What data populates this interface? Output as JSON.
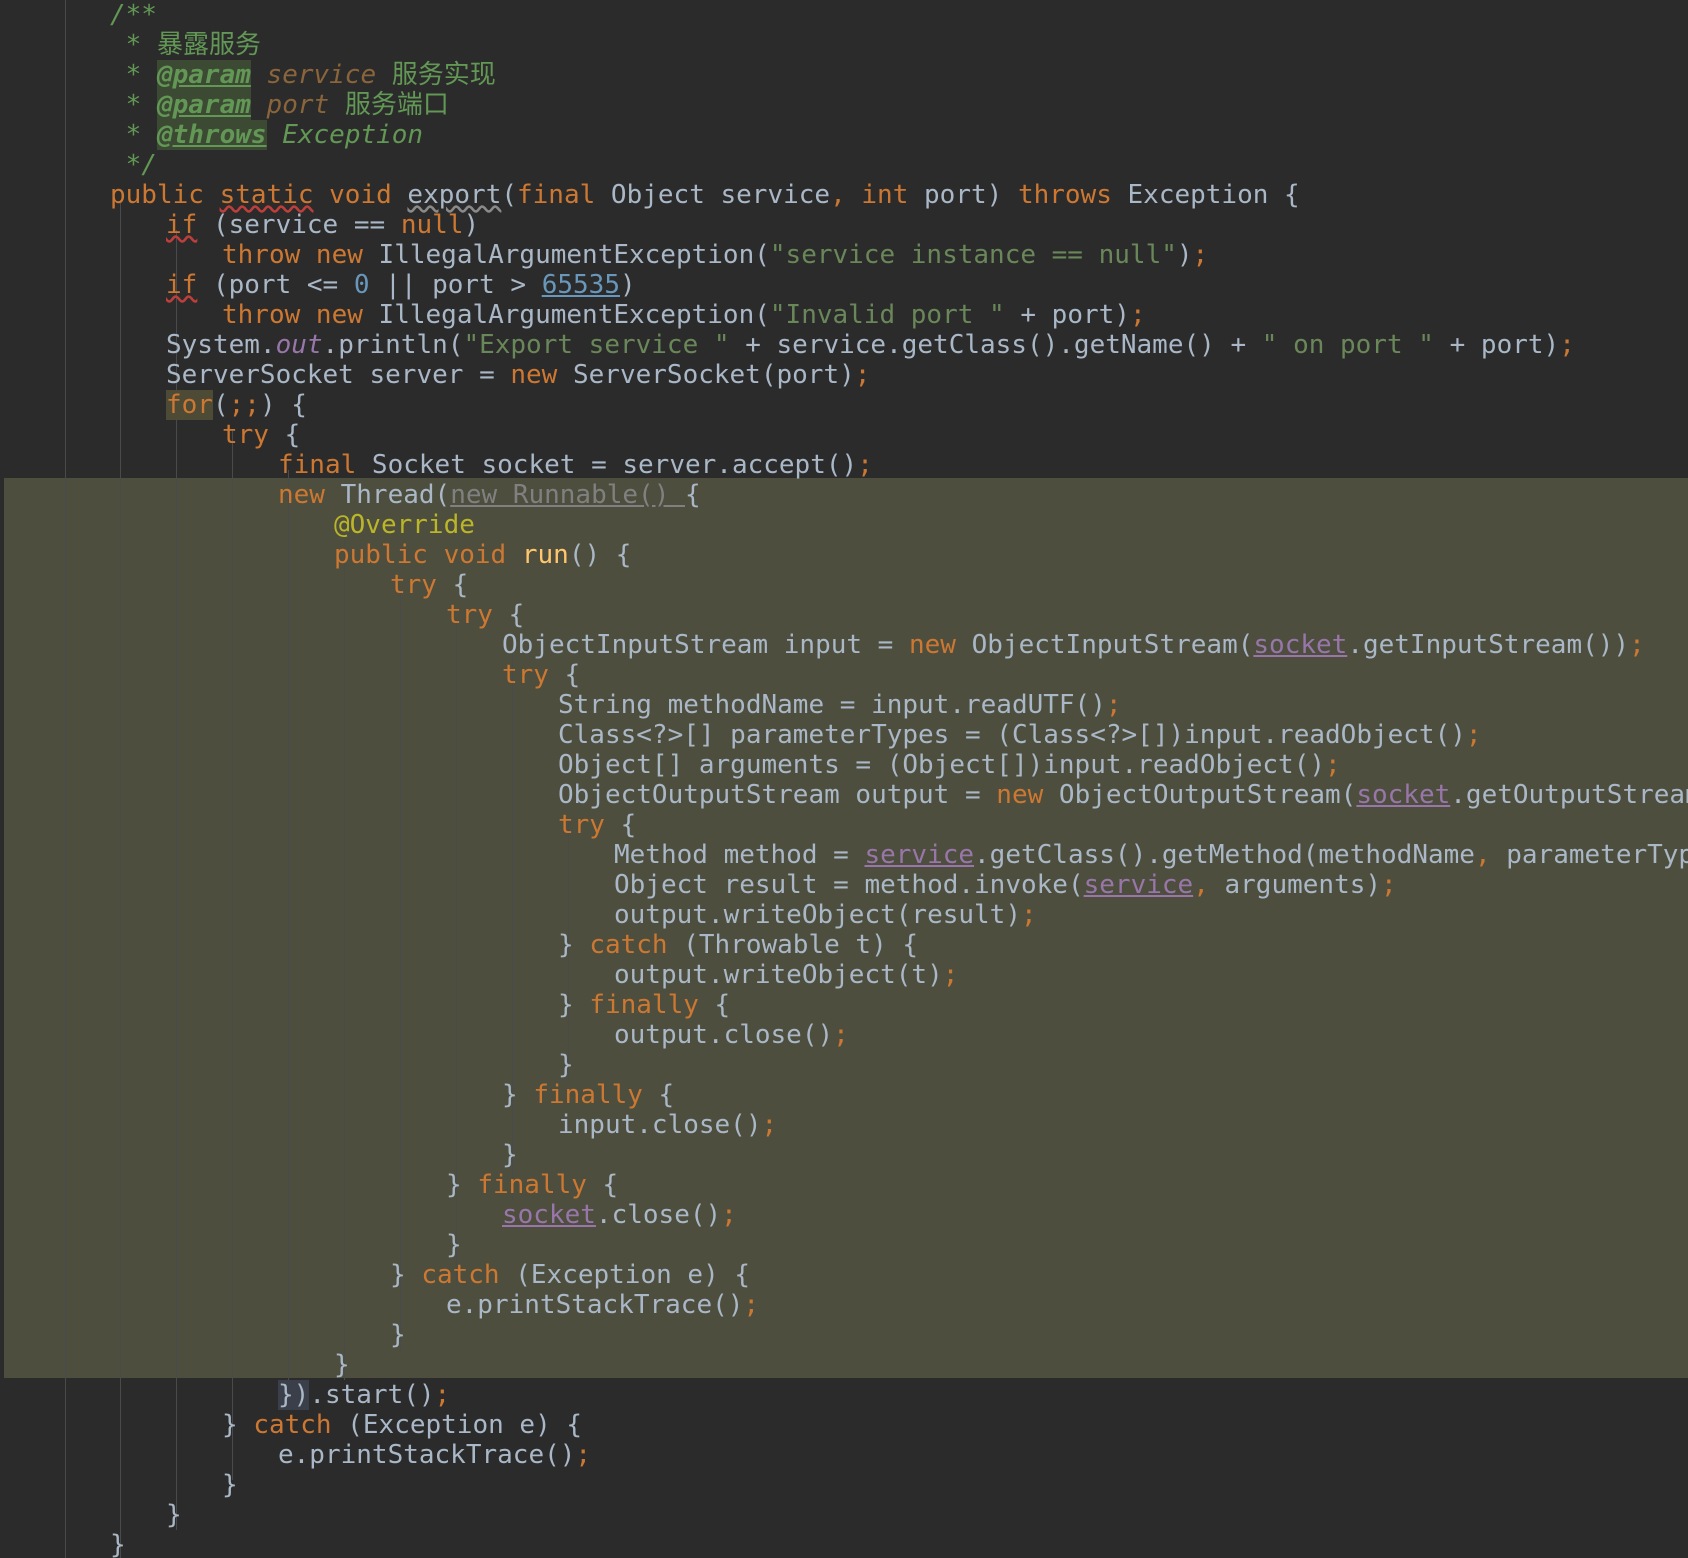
{
  "editor": {
    "colors": {
      "background": "#2b2b2b",
      "highlight_band": "#4d4e3d",
      "keyword": "#cc7832",
      "string": "#6a8759",
      "comment": "#629755",
      "number": "#6897bb",
      "method_decl": "#ffc66d",
      "field": "#9876aa",
      "annotation": "#bbb529",
      "plain": "#a9b7c6"
    },
    "lines": [
      [
        [
          "c-cmt",
          "/**"
        ]
      ],
      [
        [
          "c-cmt",
          " * "
        ],
        [
          "c-cmt-cjk",
          "暴露服务"
        ]
      ],
      [
        [
          "c-cmt",
          " * "
        ],
        [
          "c-tag",
          "@param"
        ],
        [
          "c-pname",
          " service "
        ],
        [
          "c-cmt-cjk",
          "服务实现"
        ]
      ],
      [
        [
          "c-cmt",
          " * "
        ],
        [
          "c-tag",
          "@param"
        ],
        [
          "c-pname",
          " port "
        ],
        [
          "c-cmt-cjk",
          "服务端口"
        ]
      ],
      [
        [
          "c-cmt",
          " * "
        ],
        [
          "c-tag",
          "@throws"
        ],
        [
          "c-cmt",
          " Exception"
        ]
      ],
      [
        [
          "c-cmt",
          " */"
        ]
      ],
      [
        [
          "c-kw",
          "public "
        ],
        [
          "c-kwsq",
          "static"
        ],
        [
          "c-kw",
          " void "
        ],
        [
          "c-plainsq",
          "export"
        ],
        [
          "c-plain",
          "("
        ],
        [
          "c-kw",
          "final "
        ],
        [
          "c-plain",
          "Object service"
        ],
        [
          "c-punct",
          ", "
        ],
        [
          "c-kw",
          "int "
        ],
        [
          "c-plain",
          "port) "
        ],
        [
          "c-kw",
          "throws "
        ],
        [
          "c-plain",
          "Exception {"
        ]
      ],
      [
        [
          "c-kwsq",
          "if"
        ],
        [
          "c-plain",
          " (service == "
        ],
        [
          "c-kw",
          "null"
        ],
        [
          "c-plain",
          ")"
        ]
      ],
      [
        [
          "c-kw",
          "throw new "
        ],
        [
          "c-plain",
          "IllegalArgumentException("
        ],
        [
          "c-str",
          "\"service instance == null\""
        ],
        [
          "c-plain",
          ")"
        ],
        [
          "c-punct",
          ";"
        ]
      ],
      [
        [
          "c-kwsq",
          "if"
        ],
        [
          "c-plain",
          " (port <= "
        ],
        [
          "c-num",
          "0"
        ],
        [
          "c-plain",
          " || port > "
        ],
        [
          "c-numul",
          "65535"
        ],
        [
          "c-plain",
          ")"
        ]
      ],
      [
        [
          "c-kw",
          "throw new "
        ],
        [
          "c-plain",
          "IllegalArgumentException("
        ],
        [
          "c-str",
          "\"Invalid port \""
        ],
        [
          "c-plain",
          " + port)"
        ],
        [
          "c-punct",
          ";"
        ]
      ],
      [
        [
          "c-plain",
          "System."
        ],
        [
          "c-field",
          "out"
        ],
        [
          "c-plain",
          ".println("
        ],
        [
          "c-str",
          "\"Export service \""
        ],
        [
          "c-plain",
          " + service.getClass().getName() + "
        ],
        [
          "c-str",
          "\" on port \""
        ],
        [
          "c-plain",
          " + port)"
        ],
        [
          "c-punct",
          ";"
        ]
      ],
      [
        [
          "c-plain",
          "ServerSocket server = "
        ],
        [
          "c-kw",
          "new "
        ],
        [
          "c-plain",
          "ServerSocket(port)"
        ],
        [
          "c-punct",
          ";"
        ]
      ],
      [
        [
          "c-for",
          "for"
        ],
        [
          "c-plain",
          "("
        ],
        [
          "c-punct",
          ";;"
        ],
        [
          "c-plain",
          ") {"
        ]
      ],
      [
        [
          "c-kw",
          "try "
        ],
        [
          "c-plain",
          "{"
        ]
      ],
      [
        [
          "c-kw",
          "final "
        ],
        [
          "c-plain",
          "Socket socket = server.accept()"
        ],
        [
          "c-punct",
          ";"
        ]
      ],
      [
        [
          "c-kw",
          "new "
        ],
        [
          "c-plain",
          "Thread("
        ],
        [
          "c-gray",
          "new Runnable() "
        ],
        [
          "c-plain",
          "{"
        ]
      ],
      [
        [
          "c-ann",
          "@Override"
        ]
      ],
      [
        [
          "c-kw",
          "public void "
        ],
        [
          "c-method",
          "run"
        ],
        [
          "c-plain",
          "() {"
        ]
      ],
      [
        [
          "c-kw",
          "try "
        ],
        [
          "c-plain",
          "{"
        ]
      ],
      [
        [
          "c-kw",
          "try "
        ],
        [
          "c-plain",
          "{"
        ]
      ],
      [
        [
          "c-plain",
          "ObjectInputStream input = "
        ],
        [
          "c-kw",
          "new "
        ],
        [
          "c-plain",
          "ObjectInputStream("
        ],
        [
          "c-var",
          "socket"
        ],
        [
          "c-plain",
          ".getInputStream())"
        ],
        [
          "c-punct",
          ";"
        ]
      ],
      [
        [
          "c-kw",
          "try "
        ],
        [
          "c-plain",
          "{"
        ]
      ],
      [
        [
          "c-plain",
          "String methodName = input.readUTF()"
        ],
        [
          "c-punct",
          ";"
        ]
      ],
      [
        [
          "c-plain",
          "Class<?>[] parameterTypes = (Class<?>[])input.readObject()"
        ],
        [
          "c-punct",
          ";"
        ]
      ],
      [
        [
          "c-plain",
          "Object[] arguments = (Object[])input.readObject()"
        ],
        [
          "c-punct",
          ";"
        ]
      ],
      [
        [
          "c-plain",
          "ObjectOutputStream output = "
        ],
        [
          "c-kw",
          "new "
        ],
        [
          "c-plain",
          "ObjectOutputStream("
        ],
        [
          "c-var",
          "socket"
        ],
        [
          "c-plain",
          ".getOutputStream())"
        ],
        [
          "c-punct",
          ";"
        ]
      ],
      [
        [
          "c-kw",
          "try "
        ],
        [
          "c-plain",
          "{"
        ]
      ],
      [
        [
          "c-plain",
          "Method method = "
        ],
        [
          "c-var",
          "service"
        ],
        [
          "c-plain",
          ".getClass().getMethod(methodName"
        ],
        [
          "c-punct",
          ", "
        ],
        [
          "c-plain",
          "parameterTypes)"
        ],
        [
          "c-punct",
          ";"
        ]
      ],
      [
        [
          "c-plain",
          "Object result = method.invoke("
        ],
        [
          "c-var",
          "service"
        ],
        [
          "c-punct",
          ", "
        ],
        [
          "c-plain",
          "arguments)"
        ],
        [
          "c-punct",
          ";"
        ]
      ],
      [
        [
          "c-plain",
          "output.writeObject(result)"
        ],
        [
          "c-punct",
          ";"
        ]
      ],
      [
        [
          "c-plain",
          "} "
        ],
        [
          "c-kw",
          "catch "
        ],
        [
          "c-plain",
          "(Throwable t) {"
        ]
      ],
      [
        [
          "c-plain",
          "output.writeObject(t)"
        ],
        [
          "c-punct",
          ";"
        ]
      ],
      [
        [
          "c-plain",
          "} "
        ],
        [
          "c-kw",
          "finally "
        ],
        [
          "c-plain",
          "{"
        ]
      ],
      [
        [
          "c-plain",
          "output.close()"
        ],
        [
          "c-punct",
          ";"
        ]
      ],
      [
        [
          "c-plain",
          "}"
        ]
      ],
      [
        [
          "c-plain",
          "} "
        ],
        [
          "c-kw",
          "finally "
        ],
        [
          "c-plain",
          "{"
        ]
      ],
      [
        [
          "c-plain",
          "input.close()"
        ],
        [
          "c-punct",
          ";"
        ]
      ],
      [
        [
          "c-plain",
          "}"
        ]
      ],
      [
        [
          "c-plain",
          "} "
        ],
        [
          "c-kw",
          "finally "
        ],
        [
          "c-plain",
          "{"
        ]
      ],
      [
        [
          "c-var",
          "socket"
        ],
        [
          "c-plain",
          ".close()"
        ],
        [
          "c-punct",
          ";"
        ]
      ],
      [
        [
          "c-plain",
          "}"
        ]
      ],
      [
        [
          "c-plain",
          "} "
        ],
        [
          "c-kw",
          "catch "
        ],
        [
          "c-plain",
          "(Exception e) {"
        ]
      ],
      [
        [
          "c-plain",
          "e.printStackTrace()"
        ],
        [
          "c-punct",
          ";"
        ]
      ],
      [
        [
          "c-plain",
          "}"
        ]
      ],
      [
        [
          "c-plain",
          "}"
        ]
      ],
      [
        [
          "c-sel",
          "})"
        ],
        [
          "c-plain",
          ".start()"
        ],
        [
          "c-punct",
          ";"
        ]
      ],
      [
        [
          "c-plain",
          "} "
        ],
        [
          "c-kw",
          "catch "
        ],
        [
          "c-plain",
          "(Exception e) {"
        ]
      ],
      [
        [
          "c-plain",
          "e.printStackTrace()"
        ],
        [
          "c-punct",
          ";"
        ]
      ],
      [
        [
          "c-plain",
          "}"
        ]
      ],
      [
        [
          "c-plain",
          "}"
        ]
      ],
      [
        [
          "c-plain",
          "}"
        ]
      ]
    ]
  }
}
